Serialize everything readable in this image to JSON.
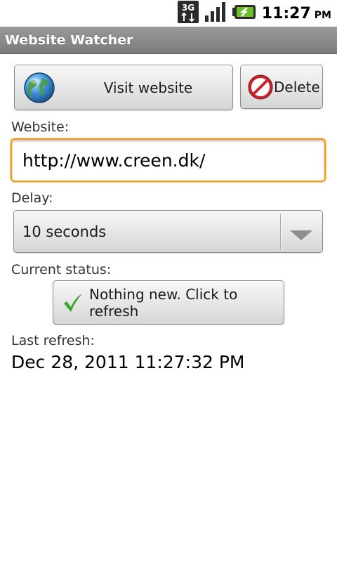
{
  "status_bar": {
    "network_type": "3G",
    "time": "11:27",
    "ampm": "PM"
  },
  "app": {
    "title": "Website Watcher"
  },
  "buttons": {
    "visit_label": "Visit website",
    "delete_label": "Delete"
  },
  "website": {
    "label": "Website:",
    "value": "http://www.creen.dk/"
  },
  "delay": {
    "label": "Delay:",
    "selected": "10 seconds"
  },
  "status": {
    "label": "Current status:",
    "button_label": "Nothing new. Click to refresh"
  },
  "last_refresh": {
    "label": "Last refresh:",
    "value": "Dec 28, 2011 11:27:32 PM"
  },
  "icons": {
    "network": "3g-data-icon",
    "signal": "signal-strength-icon",
    "battery": "battery-charging-icon",
    "visit": "globe-icon",
    "delete": "delete-no-entry-icon",
    "status": "checkmark-icon",
    "dropdown": "dropdown-arrow-icon"
  },
  "colors": {
    "focus_border": "#f39c1f",
    "title_bar": "#8a8a8a",
    "battery_green": "#6dbf2a",
    "check_green": "#3aa62b",
    "delete_red": "#c8242a"
  }
}
